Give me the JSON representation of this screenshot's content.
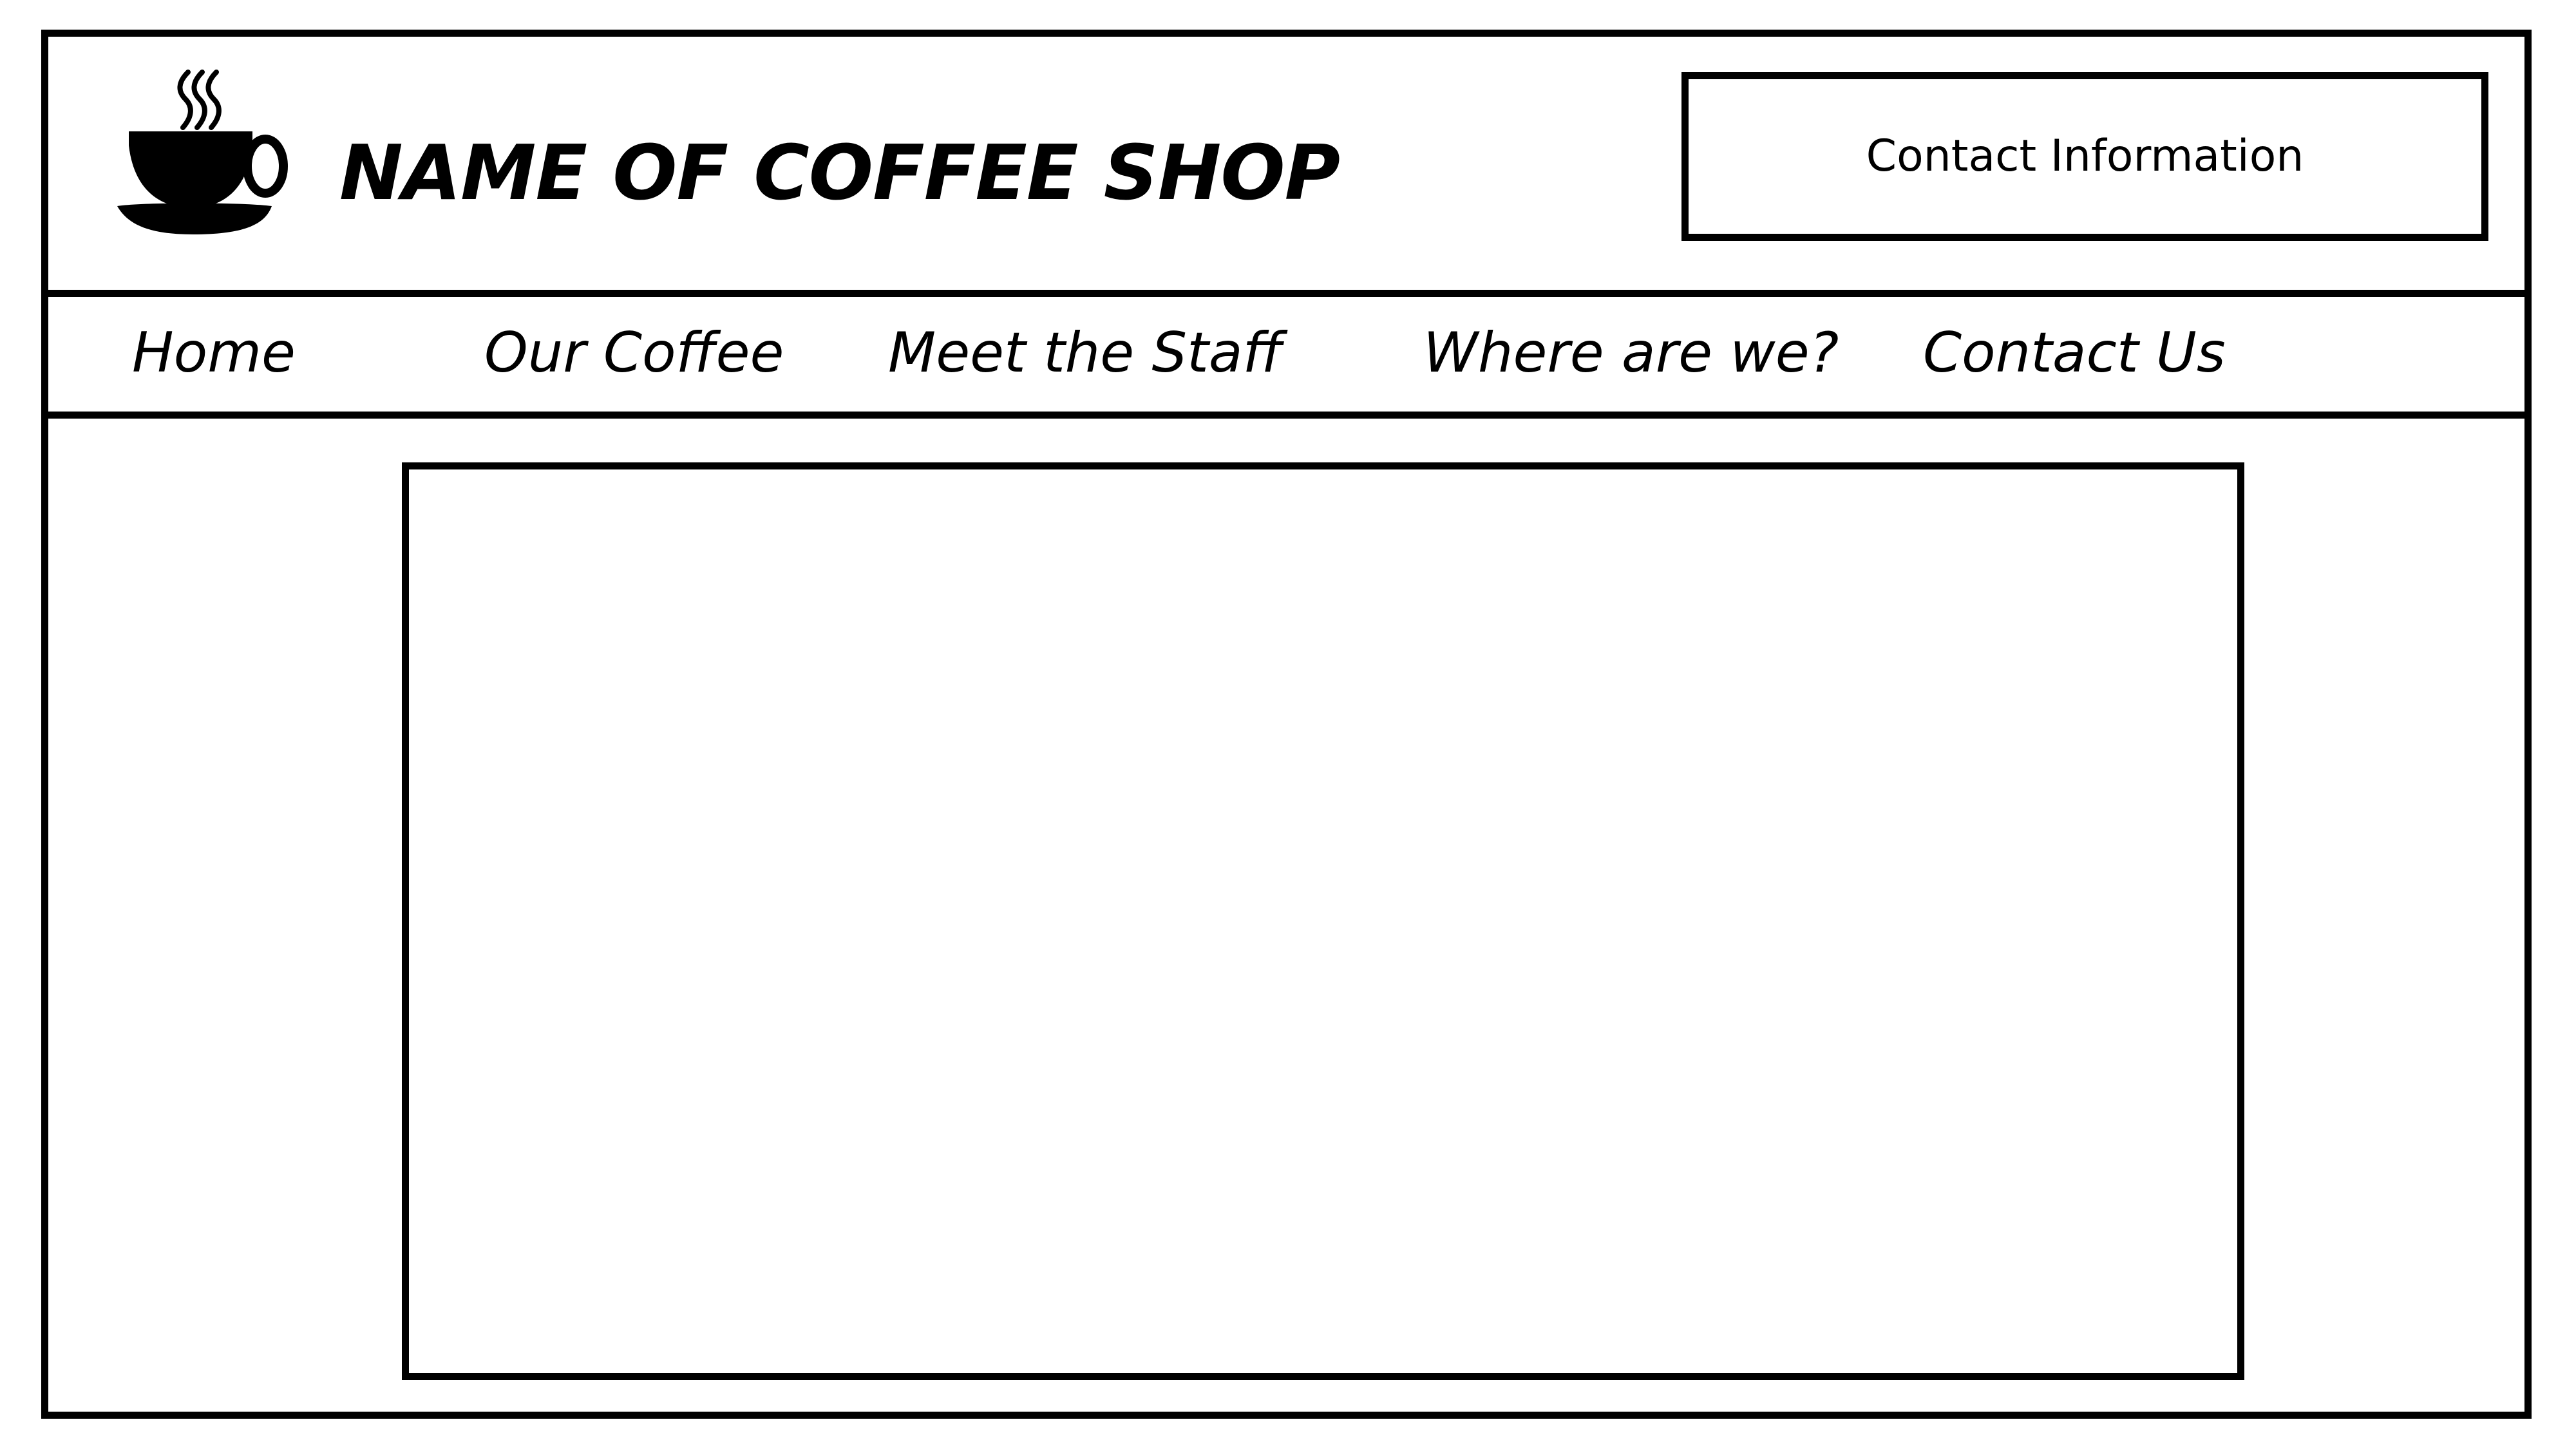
{
  "header": {
    "title": "NAME OF COFFEE SHOP",
    "logo_icon": "coffee-cup-icon",
    "contact_label": "Contact Information"
  },
  "nav": {
    "items": [
      {
        "label": "Home"
      },
      {
        "label": "Our Coffee"
      },
      {
        "label": "Meet the Staff"
      },
      {
        "label": "Where are we?"
      },
      {
        "label": "Contact Us"
      }
    ]
  },
  "colors": {
    "line": "#000000",
    "background": "#ffffff"
  }
}
